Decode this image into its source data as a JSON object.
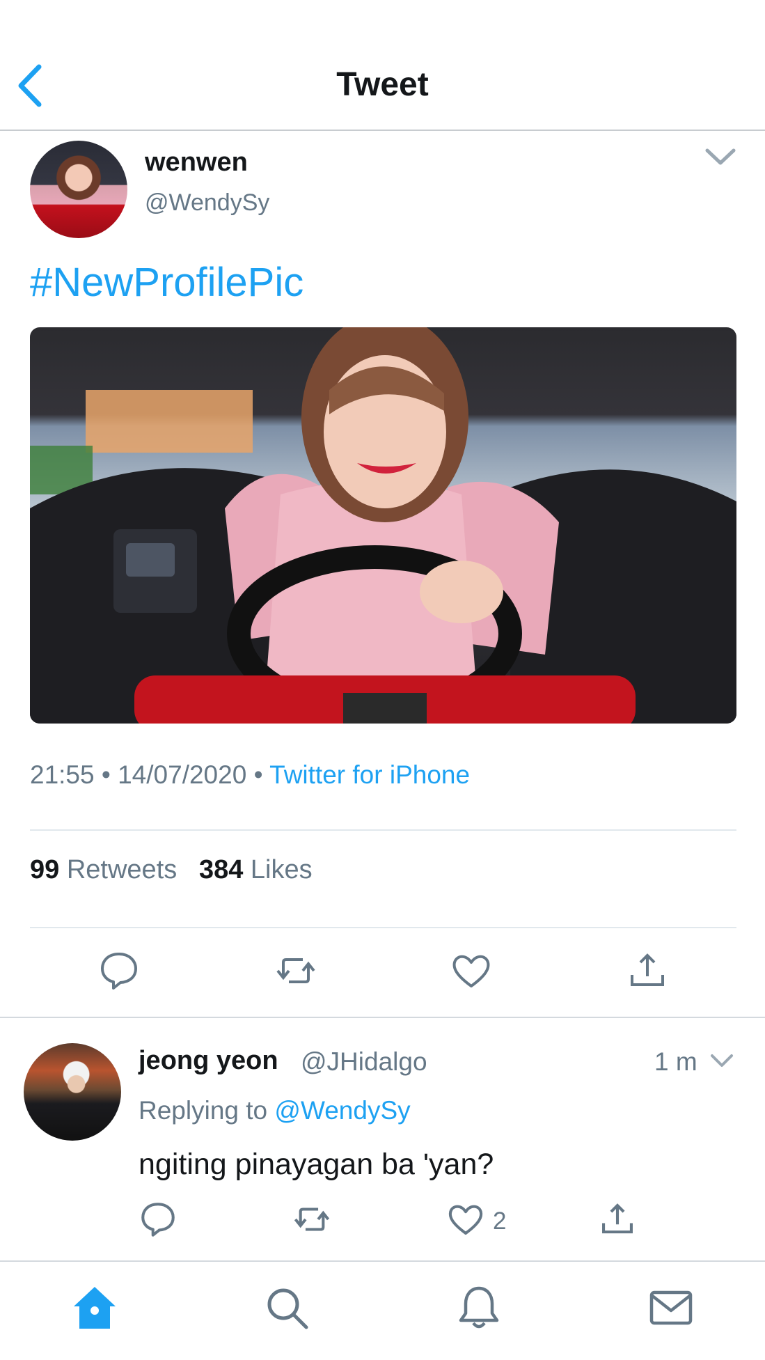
{
  "header": {
    "title": "Tweet",
    "back_icon": "chevron-left-icon"
  },
  "tweet": {
    "author_name": "wenwen",
    "author_handle": "@WendySy",
    "text": "#NewProfilePic",
    "time": "21:55",
    "date": "14/07/2020",
    "source": "Twitter for iPhone",
    "retweets": "99",
    "retweets_label": "Retweets",
    "likes": "384",
    "likes_label": "Likes",
    "actions": [
      "reply-icon",
      "retweet-icon",
      "like-icon",
      "share-icon"
    ]
  },
  "reply": {
    "author_name": "jeong yeon",
    "author_handle": "@JHidalgo",
    "time": "1 m",
    "replying_prefix": "Replying to",
    "replying_to": "@WendySy",
    "text": "ngiting pinayagan ba 'yan?",
    "like_count": "2"
  },
  "tabbar": {
    "tabs": [
      "home-icon",
      "search-icon",
      "notifications-icon",
      "messages-icon"
    ],
    "active": "home-icon"
  },
  "colors": {
    "accent": "#1da1f2",
    "secondary_text": "#657786",
    "primary_text": "#14171a",
    "divider": "#e1e8ed"
  }
}
